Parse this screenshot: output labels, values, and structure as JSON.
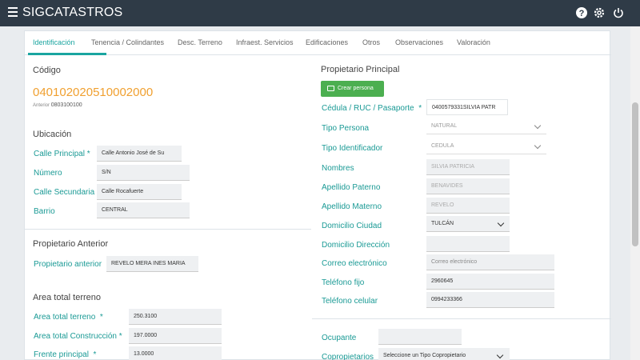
{
  "app": {
    "title": "SIGCATASTROS"
  },
  "tabs": [
    {
      "label": "Identificación"
    },
    {
      "label": "Tenencia / Colindantes"
    },
    {
      "label": "Desc. Terreno"
    },
    {
      "label": "Infraest. Servicios"
    },
    {
      "label": "Edificaciones"
    },
    {
      "label": "Otros"
    },
    {
      "label": "Observaciones"
    },
    {
      "label": "Valoración"
    }
  ],
  "identificacion": {
    "codigo_title": "Código",
    "codigo_value": "040102020510002000",
    "anterior_prefix": "Anterior",
    "anterior_value": "0803100100"
  },
  "ubicacion": {
    "title": "Ubicación",
    "calle_principal_label": "Calle Principal",
    "calle_principal_value": "Calle Antonio José de Su",
    "numero_label": "Número",
    "numero_value": "S/N",
    "calle_secundaria_label": "Calle Secundaria",
    "calle_secundaria_value": "Calle Rocafuerte",
    "barrio_label": "Barrio",
    "barrio_value": "CENTRAL"
  },
  "propietario_anterior": {
    "title": "Propietario Anterior",
    "label": "Propietario anterior",
    "value": "REVELO MERA INES MARIA"
  },
  "area_total": {
    "title": "Area total terreno",
    "area_terreno_label": "Area total terreno",
    "area_terreno_value": "250.3100",
    "area_construccion_label": "Area total Construcción",
    "area_construccion_value": "197.0000",
    "frente_label": "Frente principal",
    "frente_value": "13.0000"
  },
  "propietario_principal": {
    "title": "Propietario Principal",
    "crear_persona_label": "Crear persona",
    "cedula_label": "Cédula / RUC / Pasaporte",
    "cedula_value": "0400579331SILVIA PATR",
    "tipo_persona_label": "Tipo Persona",
    "tipo_persona_value": "NATURAL",
    "tipo_identificador_label": "Tipo Identificador",
    "tipo_identificador_value": "CEDULA",
    "nombres_label": "Nombres",
    "nombres_value": "SILVIA PATRICIA",
    "apellido_paterno_label": "Apellido Paterno",
    "apellido_paterno_value": "BENAVIDES",
    "apellido_materno_label": "Apellido Materno",
    "apellido_materno_value": "REVELO",
    "domicilio_ciudad_label": "Domicilio Ciudad",
    "domicilio_ciudad_value": "TULCÁN",
    "domicilio_direccion_label": "Domicilio Dirección",
    "domicilio_direccion_value": "",
    "correo_label": "Correo electrónico",
    "correo_placeholder": "Correo electrónico",
    "telefono_fijo_label": "Teléfono fijo",
    "telefono_fijo_value": "2960645",
    "telefono_celular_label": "Teléfono celular",
    "telefono_celular_value": "0994233366"
  },
  "ocupante": {
    "ocupante_label": "Ocupante",
    "ocupante_value": "",
    "copropietarios_label": "Copropietarios",
    "copropietarios_value": "Seleccione un Tipo Copropietario"
  },
  "required_mark": "*",
  "colors": {
    "accent": "#1aa5a0",
    "orange_code": "#f0a030",
    "topbar": "#2f3b47",
    "button_green": "#4caf50"
  }
}
